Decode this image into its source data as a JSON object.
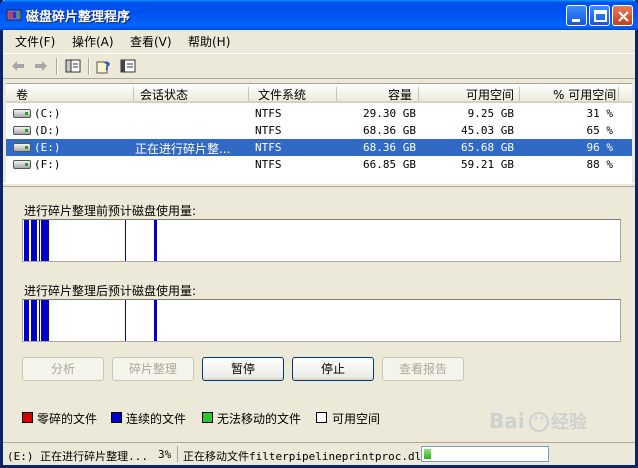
{
  "window": {
    "title": "磁盘碎片整理程序"
  },
  "menu": [
    {
      "label": "文件(F)"
    },
    {
      "label": "操作(A)"
    },
    {
      "label": "查看(V)"
    },
    {
      "label": "帮助(H)"
    }
  ],
  "toolbar": {
    "icons": [
      "back-arrow-icon",
      "forward-arrow-icon",
      "show-hide-tree-icon",
      "help-icon",
      "properties-icon"
    ]
  },
  "volumes": {
    "headers": [
      "卷",
      "会话状态",
      "文件系统",
      "容量",
      "可用空间",
      "% 可用空间"
    ],
    "rows": [
      {
        "volume": "(C:)",
        "status": "",
        "fs": "NTFS",
        "capacity": "29.30 GB",
        "free": "9.25 GB",
        "pct": "31 %",
        "selected": false
      },
      {
        "volume": "(D:)",
        "status": "",
        "fs": "NTFS",
        "capacity": "68.36 GB",
        "free": "45.03 GB",
        "pct": "65 %",
        "selected": false
      },
      {
        "volume": "(E:)",
        "status": "正在进行碎片整...",
        "fs": "NTFS",
        "capacity": "68.36 GB",
        "free": "65.68 GB",
        "pct": "96 %",
        "selected": true
      },
      {
        "volume": "(F:)",
        "status": "",
        "fs": "NTFS",
        "capacity": "66.85 GB",
        "free": "59.21 GB",
        "pct": "88 %",
        "selected": false
      }
    ]
  },
  "panels": {
    "before_label": "进行碎片整理前预计磁盘使用量:",
    "after_label": "进行碎片整理后预计磁盘使用量:"
  },
  "buttons": {
    "analyze": "分析",
    "defragment": "碎片整理",
    "pause": "暂停",
    "stop": "停止",
    "view_report": "查看报告"
  },
  "legend": {
    "fragmented": {
      "label": "零碎的文件",
      "color": "#D40000"
    },
    "contiguous": {
      "label": "连续的文件",
      "color": "#0000C8"
    },
    "unmovable": {
      "label": "无法移动的文件",
      "color": "#28C828"
    },
    "free": {
      "label": "可用空间",
      "color": "#FFFFFF"
    }
  },
  "statusbar": {
    "volume": "(E:) 正在进行碎片整理...",
    "percent": "3%",
    "message": "正在移动文件filterpipelineprintproc.dll",
    "progress": 0.03
  }
}
